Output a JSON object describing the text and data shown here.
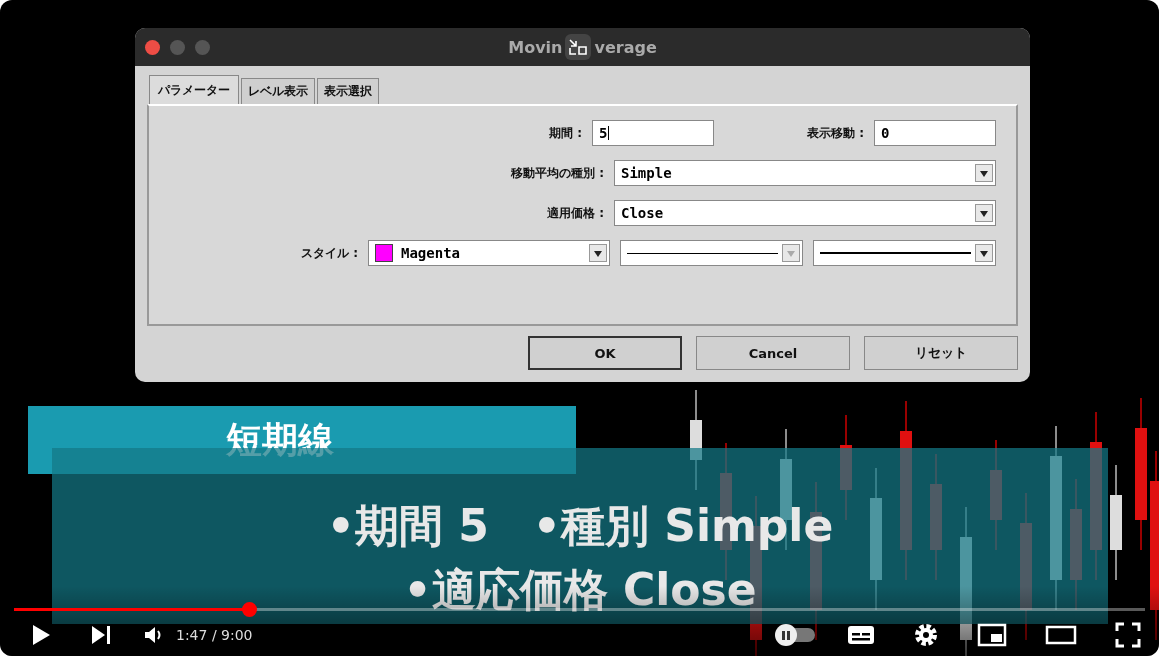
{
  "dialog": {
    "title_start": "Movin",
    "title_end": "verage",
    "tabs": [
      {
        "label": "パラメーター",
        "selected": true
      },
      {
        "label": "レベル表示",
        "selected": false
      },
      {
        "label": "表示選択",
        "selected": false
      }
    ],
    "period": {
      "label": "期間 :",
      "value": "5"
    },
    "shift": {
      "label": "表示移動 :",
      "value": "0"
    },
    "ma_type": {
      "label": "移動平均の種別 :",
      "value": "Simple"
    },
    "apply_to": {
      "label": "適用価格 :",
      "value": "Close"
    },
    "style": {
      "label": "スタイル :",
      "color_name": "Magenta",
      "color": "#ff00ff",
      "line_disabled": true
    },
    "buttons": [
      {
        "label": "OK",
        "selected": true
      },
      {
        "label": "Cancel",
        "selected": false
      },
      {
        "label": "リセット",
        "selected": false
      }
    ]
  },
  "captions": {
    "heading": "短期線",
    "lines": [
      "•期間 5　•種別 Simple",
      "•適応価格 Close"
    ]
  },
  "player": {
    "level": 0.205,
    "time": "1:47 / 9:00",
    "autoplay": false
  }
}
